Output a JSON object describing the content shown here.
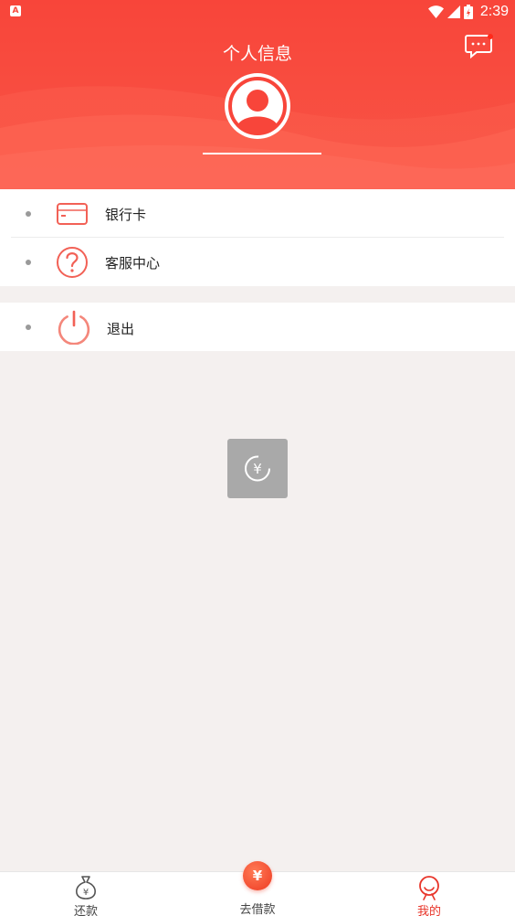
{
  "status_bar": {
    "app_icon_letter": "A",
    "time": "2:39"
  },
  "header": {
    "title": "个人信息"
  },
  "menu": {
    "items": [
      {
        "label": "银行卡",
        "icon": "bank-card-icon"
      },
      {
        "label": "客服中心",
        "icon": "question-circle-icon"
      }
    ],
    "logout": {
      "label": "退出",
      "icon": "power-icon"
    }
  },
  "loading": {
    "symbol": "¥"
  },
  "bottom_nav": {
    "items": [
      {
        "label": "还款",
        "icon": "money-bag-icon",
        "active": false
      },
      {
        "label": "去借款",
        "icon": "yen-coin-icon",
        "symbol": "¥",
        "active": false
      },
      {
        "label": "我的",
        "icon": "person-icon",
        "active": true
      }
    ]
  },
  "colors": {
    "brand": "#f8453a",
    "icon_red": "#f26156",
    "active_nav": "#e8352a",
    "background": "#f4f0ef"
  }
}
